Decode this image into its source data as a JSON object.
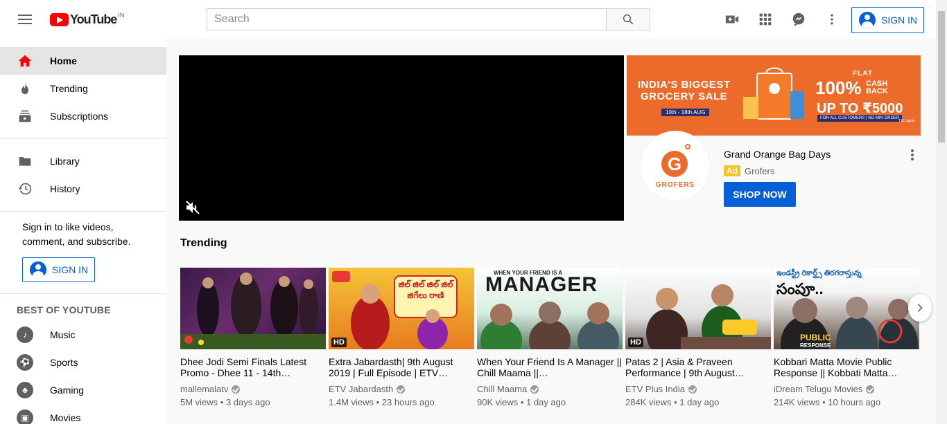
{
  "header": {
    "logo_text": "YouTube",
    "logo_country": "IN",
    "search_placeholder": "Search",
    "signin_label": "SIGN IN"
  },
  "sidebar": {
    "main_items": [
      {
        "label": "Home",
        "icon": "home-icon",
        "active": true
      },
      {
        "label": "Trending",
        "icon": "trending-icon"
      },
      {
        "label": "Subscriptions",
        "icon": "subscriptions-icon"
      }
    ],
    "library_items": [
      {
        "label": "Library",
        "icon": "library-icon"
      },
      {
        "label": "History",
        "icon": "history-icon"
      }
    ],
    "signin_prompt": "Sign in to like videos, comment, and subscribe.",
    "signin_label": "SIGN IN",
    "best_heading": "BEST OF YOUTUBE",
    "best_items": [
      {
        "label": "Music",
        "icon": "music-icon"
      },
      {
        "label": "Sports",
        "icon": "sports-icon"
      },
      {
        "label": "Gaming",
        "icon": "gaming-icon"
      },
      {
        "label": "Movies",
        "icon": "movies-icon"
      }
    ]
  },
  "ad": {
    "banner_line1": "INDIA'S BIGGEST",
    "banner_line2": "GROCERY SALE",
    "banner_dates": "10th - 18th AUG",
    "banner_flat": "FLAT",
    "banner_pct": "100%",
    "banner_cashback": "CASH BACK",
    "banner_upto": "UP TO ₹5000",
    "banner_small": "FOR ALL CUSTOMERS | NO MIN ORDER",
    "banner_tc": "T&C apply",
    "logo_letter": "G",
    "logo_text": "GROFERS",
    "title": "Grand Orange Bag Days",
    "badge": "Ad",
    "advertiser": "Grofers",
    "cta": "SHOP NOW",
    "brand_color": "#ec6a2a"
  },
  "trending": {
    "title": "Trending",
    "videos": [
      {
        "title": "Dhee Jodi Semi Finals Latest Promo - Dhee 11 - 14th…",
        "channel": "mallemalatv",
        "stats": "5M views • 3 days ago",
        "hd": false
      },
      {
        "title": "Extra Jabardasth| 9th August 2019 | Full Episode | ETV…",
        "channel": "ETV Jabardasth",
        "stats": "1.4M views • 23 hours ago",
        "hd": true
      },
      {
        "title": "When Your Friend Is A Manager || Chill Maama ||…",
        "channel": "Chill Maama",
        "stats": "90K views • 1 day ago",
        "hd": false
      },
      {
        "title": "Patas 2 | Asia & Praveen Performance | 9th August…",
        "channel": "ETV Plus India",
        "stats": "284K views • 1 day ago",
        "hd": true
      },
      {
        "title": "Kobbari Matta Movie Public Response || Kobbati Matta…",
        "channel": "iDream Telugu Movies",
        "stats": "214K views • 10 hours ago",
        "hd": false
      }
    ],
    "hd_label": "HD",
    "thumb2_text": "జిల్ జిల్ జిల్ జిల్ జిగేలు రాణి",
    "thumb3_text_small": "WHEN YOUR FRIEND IS A",
    "thumb3_text": "MANAGER",
    "thumb5_text_top": "ఇండస్ట్రీ రికార్డ్స్ తిరగరాస్తున్న",
    "thumb5_text": "సంపూ..",
    "thumb5_public": "PUBLIC",
    "thumb5_response": "RESPONSE"
  }
}
